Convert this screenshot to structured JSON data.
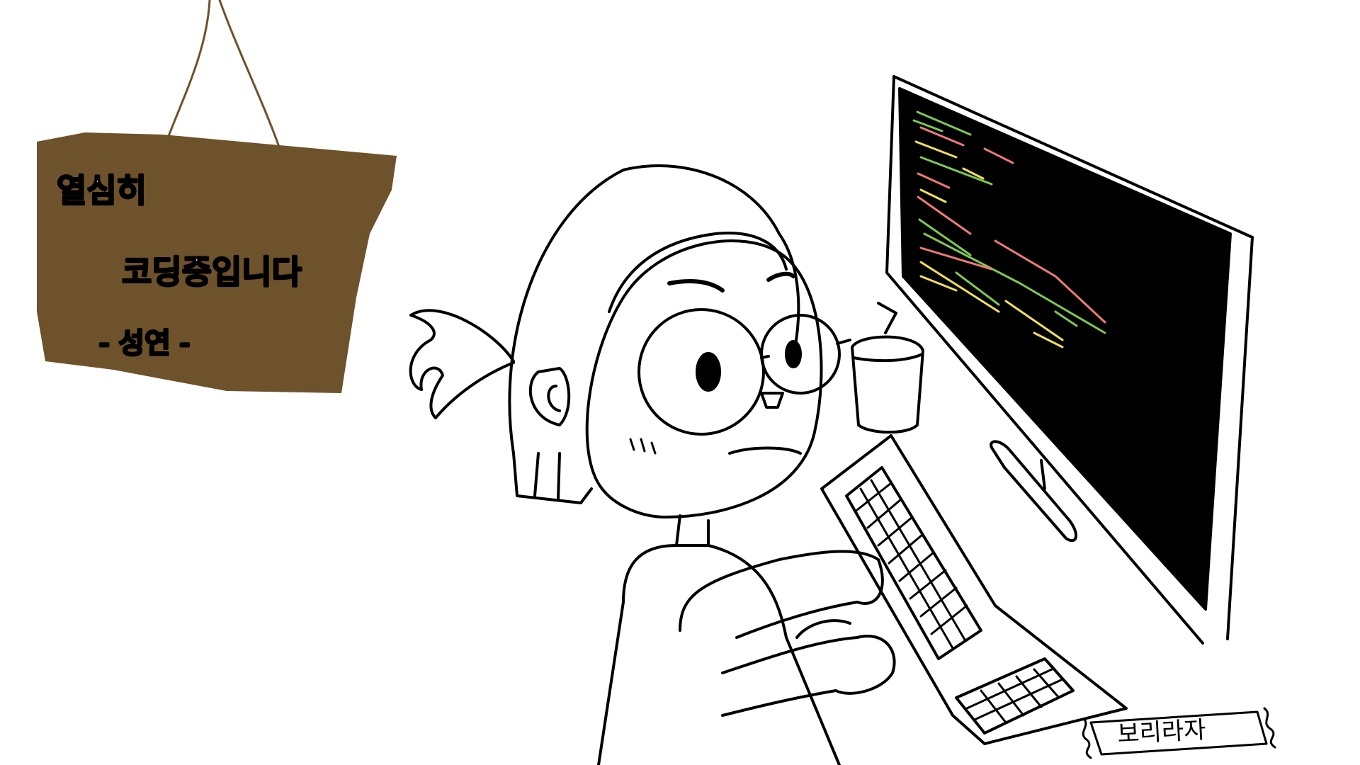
{
  "sign": {
    "line1": "열심히",
    "line2": "코딩중입니다",
    "line3": "- 성연 -",
    "board_color": "#6e522c",
    "string_color": "#6e522c",
    "text_color": "#ffffff"
  },
  "signature": {
    "text": "보리라자"
  },
  "screen": {
    "background_color": "#000000",
    "code_colors": [
      "#7ec850",
      "#f07a7a",
      "#f0e05a"
    ]
  }
}
